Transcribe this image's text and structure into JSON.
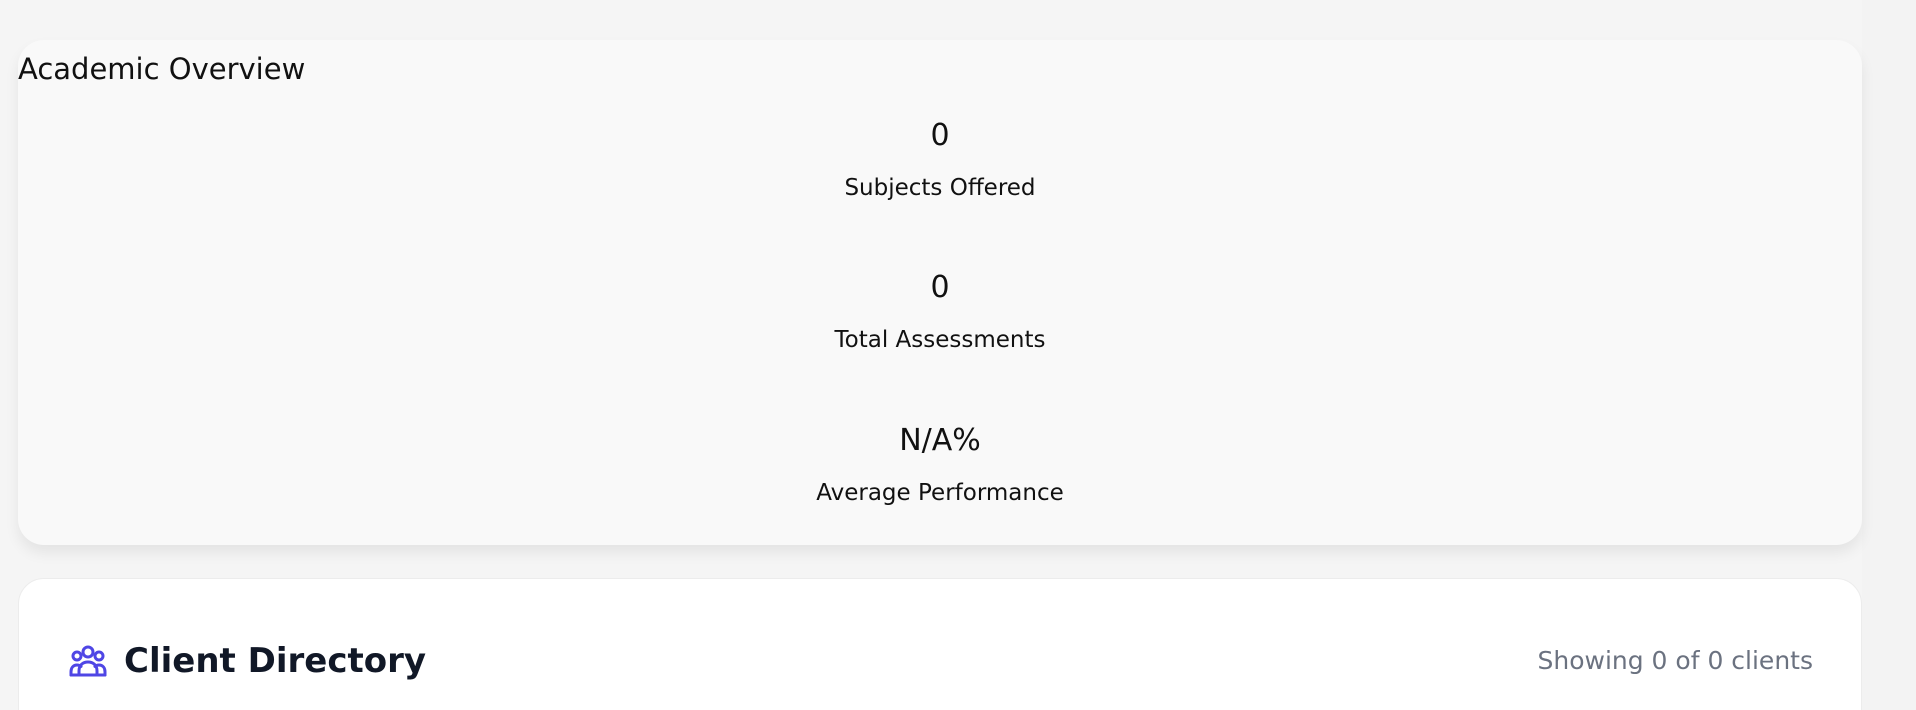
{
  "academic_overview": {
    "title": "Academic Overview",
    "stats": [
      {
        "value": "0",
        "label": "Subjects Offered"
      },
      {
        "value": "0",
        "label": "Total Assessments"
      },
      {
        "value": "N/A%",
        "label": "Average Performance"
      }
    ]
  },
  "client_directory": {
    "icon": "users-icon",
    "title": "Client Directory",
    "count_text": "Showing 0 of 0 clients",
    "accent_color": "#4f46e5"
  }
}
